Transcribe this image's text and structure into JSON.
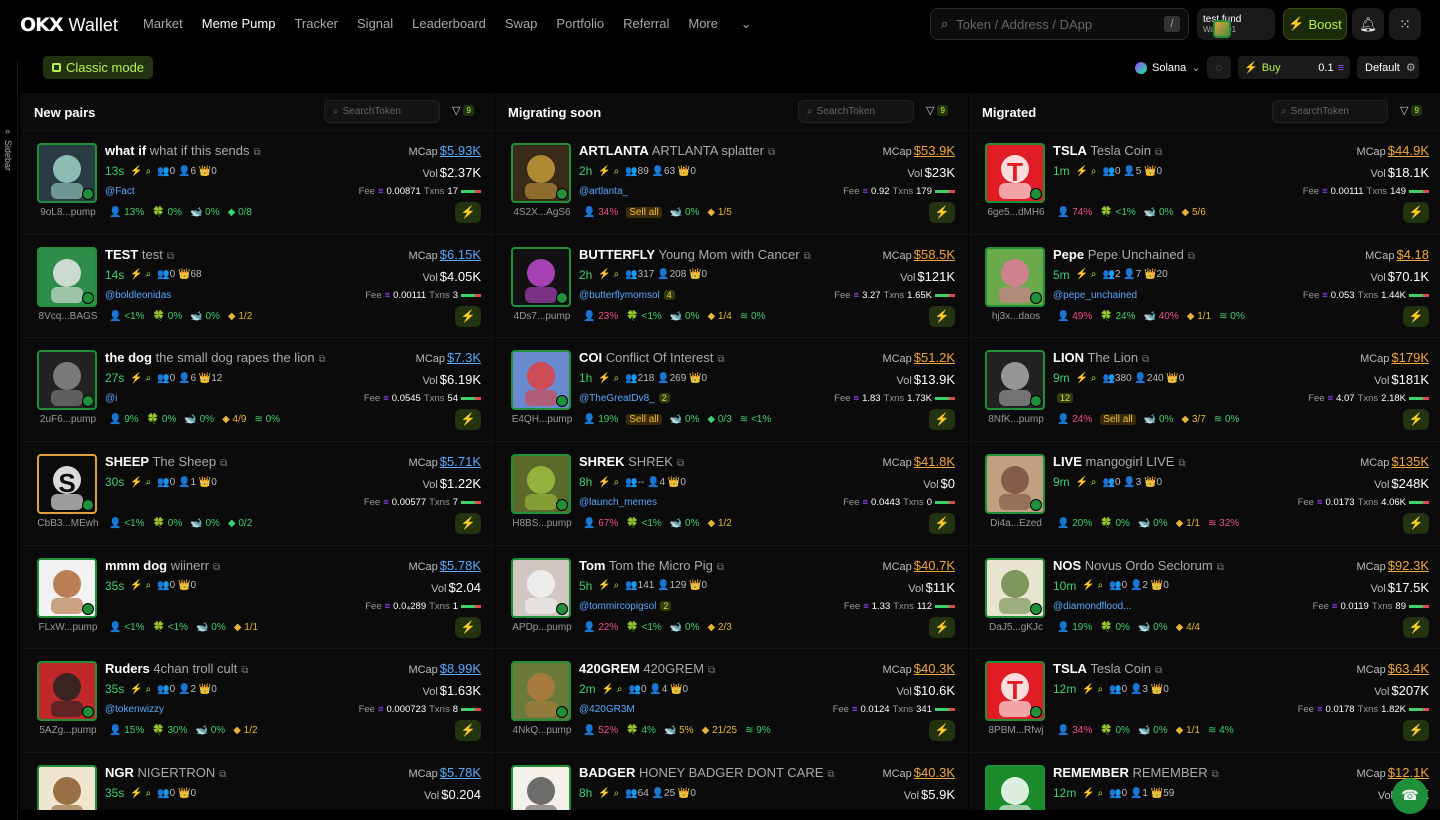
{
  "header": {
    "logo_mark": "OKX",
    "logo_text": "Wallet",
    "nav": [
      "Market",
      "Meme Pump",
      "Tracker",
      "Signal",
      "Leaderboard",
      "Swap",
      "Portfolio",
      "Referral",
      "More"
    ],
    "active_nav": "Meme Pump",
    "search_placeholder": "Token / Address / DApp",
    "search_shortcut": "/",
    "wallet_name": "test fund",
    "wallet_sub": "Wallet 01",
    "boost": "Boost"
  },
  "sidebar_label": "Sidebar",
  "toolbar": {
    "classic_mode": "Classic mode",
    "chain": "Solana",
    "buy_label": "Buy",
    "buy_amount": "0.1",
    "preset": "Default"
  },
  "columns": [
    {
      "title": "New pairs",
      "search_placeholder": "SearchToken",
      "filter_count": "9",
      "cards": [
        {
          "sym": "what if",
          "name": "what if this sends",
          "addr": "9oL8...pump",
          "age": "13s",
          "stats": "👥0 👤6 👑0",
          "handle": "@Fact",
          "boost": "",
          "mcap": "$5.93K",
          "vol": "$2.37K",
          "fee": "0.00871",
          "txns": "17",
          "tags": [
            [
              "g",
              "👤 13%"
            ],
            [
              "g",
              "🍀 0%"
            ],
            [
              "g",
              "🐋 0%"
            ],
            [
              "g",
              "◆ 0/8"
            ]
          ]
        },
        {
          "sym": "TEST",
          "name": "test",
          "addr": "8Vcq...BAGS",
          "age": "14s",
          "stats": "👥0 👑68",
          "handle": "@boldleonidas",
          "boost": "",
          "mcap": "$6.15K",
          "vol": "$4.05K",
          "fee": "0.00111",
          "txns": "3",
          "tags": [
            [
              "g",
              "👤 <1%"
            ],
            [
              "g",
              "🍀 0%"
            ],
            [
              "g",
              "🐋 0%"
            ],
            [
              "y",
              "◆ 1/2"
            ]
          ]
        },
        {
          "sym": "the dog",
          "name": "the small dog rapes the lion",
          "addr": "2uF6...pump",
          "age": "27s",
          "stats": "👥0 👤6 👑12",
          "handle": "@i",
          "boost": "",
          "mcap": "$7.3K",
          "vol": "$6.19K",
          "fee": "0.0545",
          "txns": "54",
          "tags": [
            [
              "g",
              "👤 9%"
            ],
            [
              "g",
              "🍀 0%"
            ],
            [
              "g",
              "🐋 0%"
            ],
            [
              "y",
              "◆ 4/9"
            ],
            [
              "g",
              "≋ 0%"
            ]
          ]
        },
        {
          "sym": "SHEEP",
          "name": "The Sheep",
          "addr": "CbB3...MEwh",
          "age": "30s",
          "stats": "👥0 👤1 👑0",
          "handle": "",
          "boost": "",
          "mcap": "$5.71K",
          "vol": "$1.22K",
          "fee": "0.00577",
          "txns": "7",
          "tags": [
            [
              "g",
              "👤 <1%"
            ],
            [
              "g",
              "🍀 0%"
            ],
            [
              "g",
              "🐋 0%"
            ],
            [
              "g",
              "◆ 0/2"
            ]
          ]
        },
        {
          "sym": "mmm dog",
          "name": "wiinerr",
          "addr": "FLxW...pump",
          "age": "35s",
          "stats": "👥0 👑0",
          "handle": "",
          "boost": "",
          "mcap": "$5.78K",
          "vol": "$2.04",
          "fee": "0.0₄289",
          "txns": "1",
          "tags": [
            [
              "g",
              "👤 <1%"
            ],
            [
              "g",
              "🍀 <1%"
            ],
            [
              "g",
              "🐋 0%"
            ],
            [
              "y",
              "◆ 1/1"
            ]
          ]
        },
        {
          "sym": "Ruders",
          "name": "4chan troll cult",
          "addr": "5AZg...pump",
          "age": "35s",
          "stats": "👥0 👤2 👑0",
          "handle": "@tokenwizzy",
          "boost": "",
          "mcap": "$8.99K",
          "vol": "$1.63K",
          "fee": "0.000723",
          "txns": "8",
          "tags": [
            [
              "g",
              "👤 15%"
            ],
            [
              "g",
              "🍀 30%"
            ],
            [
              "g",
              "🐋 0%"
            ],
            [
              "y",
              "◆ 1/2"
            ]
          ]
        },
        {
          "sym": "NGR",
          "name": "NIGERTRON",
          "addr": "",
          "age": "35s",
          "stats": "👥0 👑0",
          "handle": "",
          "boost": "",
          "mcap": "$5.78K",
          "vol": "$0.204",
          "fee": "",
          "txns": "",
          "tags": []
        }
      ]
    },
    {
      "title": "Migrating soon",
      "search_placeholder": "SearchToken",
      "filter_count": "9",
      "cards": [
        {
          "sym": "ARTLANTA",
          "name": "ARTLANTA splatter",
          "addr": "4S2X...AgS6",
          "age": "2h",
          "stats": "👥89 👤63 👑0",
          "handle": "@artlanta_",
          "boost": "",
          "mcap": "$53.9K",
          "vol": "$23K",
          "fee": "0.92",
          "txns": "179",
          "tags": [
            [
              "r",
              "👤 34%"
            ],
            [
              "sell",
              "Sell all"
            ],
            [
              "g",
              "🐋 0%"
            ],
            [
              "y",
              "◆ 1/5"
            ]
          ]
        },
        {
          "sym": "BUTTERFLY",
          "name": "Young Mom with Cancer",
          "addr": "4Ds7...pump",
          "age": "2h",
          "stats": "👥317 👤208 👑0",
          "handle": "@butterflymomsol",
          "boost": "4",
          "mcap": "$58.5K",
          "vol": "$121K",
          "fee": "3.27",
          "txns": "1.65K",
          "tags": [
            [
              "r",
              "👤 23%"
            ],
            [
              "g",
              "🍀 <1%"
            ],
            [
              "g",
              "🐋 0%"
            ],
            [
              "y",
              "◆ 1/4"
            ],
            [
              "g",
              "≋ 0%"
            ]
          ]
        },
        {
          "sym": "COI",
          "name": "Conflict Of Interest",
          "addr": "E4QH...pump",
          "age": "1h",
          "stats": "👥218 👤269 👑0",
          "handle": "@TheGreatDv8_",
          "boost": "2",
          "mcap": "$51.2K",
          "vol": "$13.9K",
          "fee": "1.83",
          "txns": "1.73K",
          "tags": [
            [
              "g",
              "👤 19%"
            ],
            [
              "sell",
              "Sell all"
            ],
            [
              "g",
              "🐋 0%"
            ],
            [
              "g",
              "◆ 0/3"
            ],
            [
              "g",
              "≋ <1%"
            ]
          ]
        },
        {
          "sym": "SHREK",
          "name": "SHREK",
          "addr": "H8BS...pump",
          "age": "8h",
          "stats": "👥-- 👤4 👑0",
          "handle": "@launch_memes",
          "boost": "",
          "mcap": "$41.8K",
          "vol": "$0",
          "fee": "0.0443",
          "txns": "0",
          "tags": [
            [
              "r",
              "👤 67%"
            ],
            [
              "g",
              "🍀 <1%"
            ],
            [
              "g",
              "🐋 0%"
            ],
            [
              "y",
              "◆ 1/2"
            ]
          ]
        },
        {
          "sym": "Tom",
          "name": "Tom the Micro Pig",
          "addr": "APDp...pump",
          "age": "5h",
          "stats": "👥141 👤129 👑0",
          "handle": "@tommircopigsol",
          "boost": "2",
          "mcap": "$40.7K",
          "vol": "$11K",
          "fee": "1.33",
          "txns": "112",
          "tags": [
            [
              "r",
              "👤 22%"
            ],
            [
              "g",
              "🍀 <1%"
            ],
            [
              "g",
              "🐋 0%"
            ],
            [
              "y",
              "◆ 2/3"
            ]
          ]
        },
        {
          "sym": "420GREM",
          "name": "420GREM",
          "addr": "4NkQ...pump",
          "age": "2m",
          "stats": "👥0 👤4 👑0",
          "handle": "@420GR3M",
          "boost": "",
          "mcap": "$40.3K",
          "vol": "$10.6K",
          "fee": "0.0124",
          "txns": "341",
          "tags": [
            [
              "r",
              "👤 52%"
            ],
            [
              "g",
              "🍀 4%"
            ],
            [
              "y",
              "🐋 5%"
            ],
            [
              "y",
              "◆ 21/25"
            ],
            [
              "g",
              "≋ 9%"
            ]
          ]
        },
        {
          "sym": "BADGER",
          "name": "HONEY BADGER DONT CARE",
          "addr": "",
          "age": "8h",
          "stats": "👥64 👤25 👑0",
          "handle": "",
          "boost": "",
          "mcap": "$40.3K",
          "vol": "$5.9K",
          "fee": "",
          "txns": "",
          "tags": []
        }
      ]
    },
    {
      "title": "Migrated",
      "search_placeholder": "SearchToken",
      "filter_count": "9",
      "cards": [
        {
          "sym": "TSLA",
          "name": "Tesla Coin",
          "addr": "6ge5...dMH6",
          "age": "1m",
          "stats": "👥0 👤5 👑0",
          "handle": "",
          "boost": "",
          "mcap": "$44.9K",
          "vol": "$18.1K",
          "fee": "0.00111",
          "txns": "149",
          "tags": [
            [
              "r",
              "👤 74%"
            ],
            [
              "g",
              "🍀 <1%"
            ],
            [
              "g",
              "🐋 0%"
            ],
            [
              "y",
              "◆ 5/6"
            ]
          ]
        },
        {
          "sym": "Pepe",
          "name": "Pepe Unchained",
          "addr": "hj3x...daos",
          "age": "5m",
          "stats": "👥2 👤7 👑20",
          "handle": "@pepe_unchained",
          "boost": "",
          "mcap": "$4.18",
          "vol": "$70.1K",
          "fee": "0.053",
          "txns": "1.44K",
          "tags": [
            [
              "r",
              "👤 49%"
            ],
            [
              "g",
              "🍀 24%"
            ],
            [
              "r",
              "🐋 40%"
            ],
            [
              "y",
              "◆ 1/1"
            ],
            [
              "g",
              "≋ 0%"
            ]
          ]
        },
        {
          "sym": "LION",
          "name": "The Lion",
          "addr": "8NfK...pump",
          "age": "9m",
          "stats": "👥380 👤240 👑0",
          "handle": "",
          "boost": "12",
          "mcap": "$179K",
          "vol": "$181K",
          "fee": "4.07",
          "txns": "2.18K",
          "tags": [
            [
              "r",
              "👤 24%"
            ],
            [
              "sell",
              "Sell all"
            ],
            [
              "g",
              "🐋 0%"
            ],
            [
              "y",
              "◆ 3/7"
            ],
            [
              "g",
              "≋ 0%"
            ]
          ]
        },
        {
          "sym": "LIVE",
          "name": "mangogirl LIVE",
          "addr": "Di4a...Ezed",
          "age": "9m",
          "stats": "👥0 👤3 👑0",
          "handle": "",
          "boost": "",
          "mcap": "$135K",
          "vol": "$248K",
          "fee": "0.0173",
          "txns": "4.06K",
          "tags": [
            [
              "g",
              "👤 20%"
            ],
            [
              "g",
              "🍀 0%"
            ],
            [
              "g",
              "🐋 0%"
            ],
            [
              "y",
              "◆ 1/1"
            ],
            [
              "r",
              "≋ 32%"
            ]
          ]
        },
        {
          "sym": "NOS",
          "name": "Novus Ordo Seclorum",
          "addr": "DaJ5...gKJc",
          "age": "10m",
          "stats": "👥0 👤2 👑0",
          "handle": "@diamondflood...",
          "boost": "",
          "mcap": "$92.3K",
          "vol": "$17.5K",
          "fee": "0.0119",
          "txns": "89",
          "tags": [
            [
              "g",
              "👤 19%"
            ],
            [
              "g",
              "🍀 0%"
            ],
            [
              "g",
              "🐋 0%"
            ],
            [
              "y",
              "◆ 4/4"
            ]
          ]
        },
        {
          "sym": "TSLA",
          "name": "Tesla Coin",
          "addr": "8PBM...Rfwj",
          "age": "12m",
          "stats": "👥0 👤3 👑0",
          "handle": "",
          "boost": "",
          "mcap": "$63.4K",
          "vol": "$207K",
          "fee": "0.0178",
          "txns": "1.82K",
          "tags": [
            [
              "r",
              "👤 34%"
            ],
            [
              "g",
              "🍀 0%"
            ],
            [
              "g",
              "🐋 0%"
            ],
            [
              "y",
              "◆ 1/1"
            ],
            [
              "g",
              "≋ 4%"
            ]
          ]
        },
        {
          "sym": "REMEMBER",
          "name": "REMEMBER",
          "addr": "",
          "age": "12m",
          "stats": "👥0 👤1 👑59",
          "handle": "",
          "boost": "",
          "mcap": "$12.1K",
          "vol": "$2.6K",
          "fee": "",
          "txns": "",
          "tags": []
        }
      ]
    }
  ],
  "colors": {
    "accent": "#b6f24a",
    "green": "#3fcf6b",
    "red": "#f0508a",
    "link": "#5aa8ff",
    "orange": "#f0a640"
  }
}
